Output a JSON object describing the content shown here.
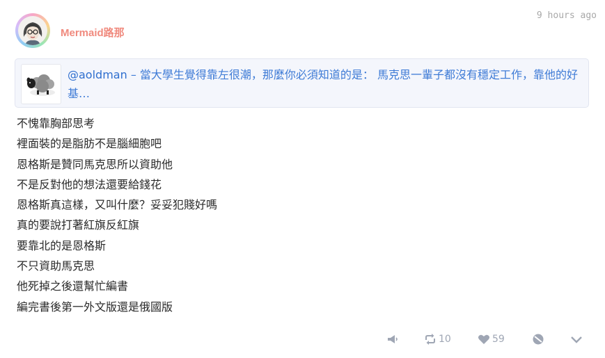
{
  "post": {
    "username": "Mermaid路那",
    "timestamp": "9 hours ago",
    "avatar_icon": "woman-portrait-avatar",
    "quote": {
      "handle": "@aoldman",
      "dash": " – ",
      "text": "當大學生覺得靠左很潮，那麼你必須知道的是： 馬克思一輩子都沒有穩定工作，靠他的好基…",
      "thumb_icon": "sheep-icon"
    },
    "body_lines": [
      "不愧靠胸部思考",
      "裡面裝的是脂肪不是腦細胞吧",
      "恩格斯是贊同馬克思所以資助他",
      "不是反對他的想法還要給錢花",
      "恩格斯真這樣，又叫什麼？妥妥犯賤好嗎",
      "真的要說打著紅旗反紅旗",
      "要靠北的是恩格斯",
      "不只資助馬克思",
      "他死掉之後還幫忙編書",
      "編完書後第一外文版還是俄國版"
    ],
    "actions": {
      "repost_count": "10",
      "like_count": "59"
    }
  },
  "colors": {
    "username": "#f08a7e",
    "quote_text": "#3e7bd6",
    "quote_bg": "#f4f6fc",
    "action_icons": "#9fa6b4",
    "timestamp": "#a8a8a8"
  }
}
